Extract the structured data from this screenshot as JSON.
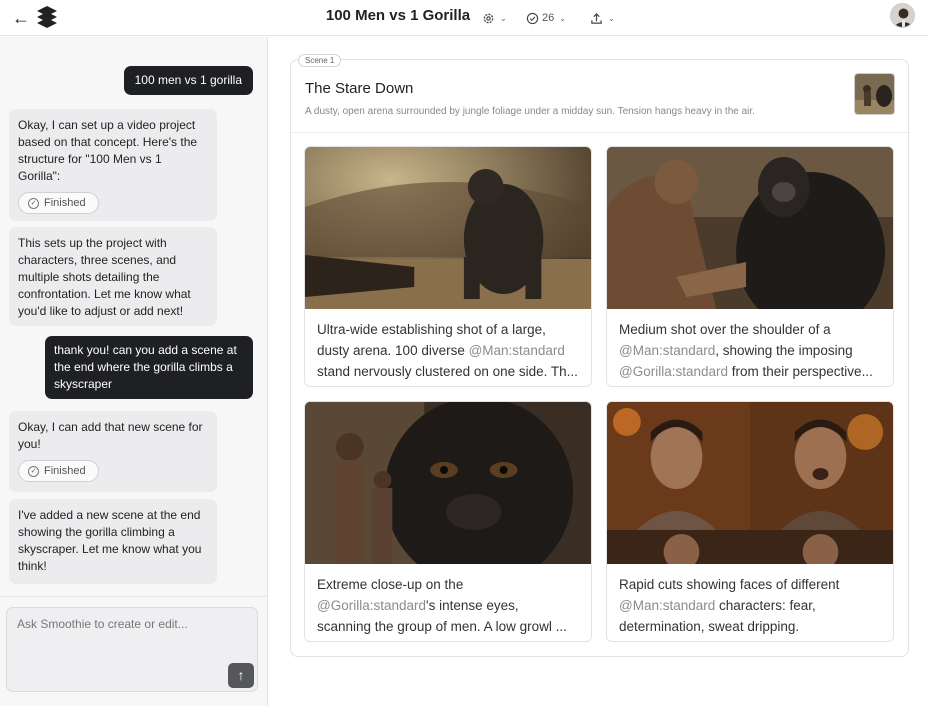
{
  "header": {
    "back_icon": "arrow-left-icon",
    "title": "100 Men vs 1 Gorilla",
    "settings_icon": "gear-icon",
    "credits_icon": "clock-icon",
    "credits": "26",
    "share_icon": "upload-icon"
  },
  "chat": {
    "messages": [
      {
        "role": "user",
        "text": "100 men vs 1 gorilla"
      },
      {
        "role": "assistant",
        "lines": [
          "Okay, I can set up a video project",
          "based on that concept. Here's the",
          "structure for \"100 Men vs 1",
          "Gorilla\":"
        ],
        "status": "Finished"
      },
      {
        "role": "assistant",
        "lines": [
          "This sets up the project with",
          "characters, three scenes, and",
          "multiple shots detailing the",
          "confrontation. Let me know what",
          "you'd like to adjust or add next!"
        ]
      },
      {
        "role": "user",
        "lines": [
          "thank you! can you add a scene at",
          "the end where the gorilla climbs a",
          "skyscraper"
        ]
      },
      {
        "role": "assistant",
        "lines": [
          "Okay, I can add that new scene for",
          "you!"
        ],
        "status": "Finished"
      },
      {
        "role": "assistant",
        "lines": [
          "I've added a new scene at the end",
          "showing the gorilla climbing a",
          "skyscraper. Let me know what you",
          "think!"
        ]
      }
    ],
    "input_placeholder": "Ask Smoothie to create or edit..."
  },
  "scene": {
    "tag": "Scene 1",
    "title": "The Stare Down",
    "description": "A dusty, open arena surrounded by jungle foliage under a midday sun. Tension hangs heavy in the air.",
    "shots": [
      {
        "lines": [
          [
            {
              "t": "Ultra-wide establishing shot of a large,"
            }
          ],
          [
            {
              "t": "dusty arena. 100 diverse "
            },
            {
              "t": "@Man:standard",
              "m": true
            }
          ],
          [
            {
              "t": "stand nervously clustered on one side. Th..."
            }
          ]
        ]
      },
      {
        "lines": [
          [
            {
              "t": "Medium shot over the shoulder of a"
            }
          ],
          [
            {
              "t": "@Man:standard",
              "m": true
            },
            {
              "t": ", showing the imposing"
            }
          ],
          [
            {
              "t": "@Gorilla:standard",
              "m": true
            },
            {
              "t": " from their perspective..."
            }
          ]
        ]
      },
      {
        "lines": [
          [
            {
              "t": "Extreme close-up on the"
            }
          ],
          [
            {
              "t": "@Gorilla:standard",
              "m": true
            },
            {
              "t": "'s intense eyes,"
            }
          ],
          [
            {
              "t": "scanning the group of men. A low growl ..."
            }
          ]
        ]
      },
      {
        "lines": [
          [
            {
              "t": "Rapid cuts showing faces of different"
            }
          ],
          [
            {
              "t": "@Man:standard",
              "m": true
            },
            {
              "t": " characters: fear,"
            }
          ],
          [
            {
              "t": "determination, sweat dripping."
            }
          ]
        ]
      }
    ]
  }
}
